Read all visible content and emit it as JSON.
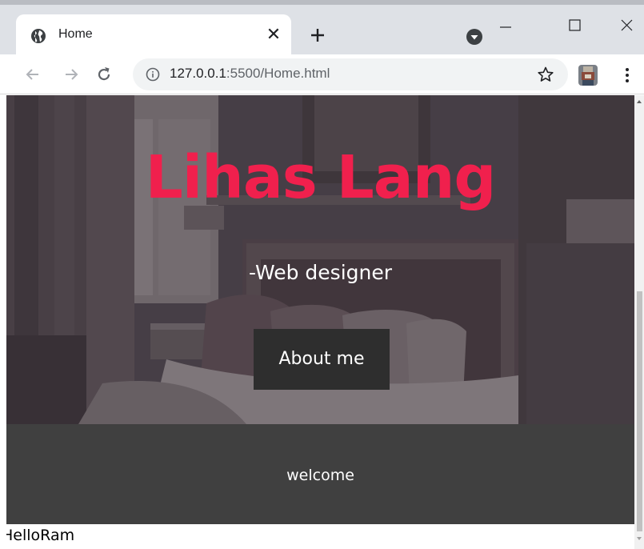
{
  "browser": {
    "tab": {
      "title": "Home",
      "favicon": "globe-icon",
      "close_glyph": "✕"
    },
    "new_tab_icon": "plus-icon",
    "media_icon": "media-control-icon",
    "window_controls": [
      "minimize-icon",
      "maximize-icon",
      "close-icon"
    ],
    "nav": {
      "back_icon": "back-arrow-icon",
      "forward_icon": "forward-arrow-icon",
      "reload_icon": "reload-icon"
    },
    "address": {
      "info_icon": "info-icon",
      "host": "127.0.0.1",
      "path": ":5500/Home.html",
      "bookmark_icon": "star-icon"
    },
    "profile_icon": "avatar",
    "menu_icon": "kebab-menu-icon"
  },
  "page": {
    "hero": {
      "title": "Lihas Lang",
      "subtitle": "-Web designer",
      "button_label": "About me"
    },
    "welcome": {
      "text": "welcome"
    },
    "footer_text": "HelloRam"
  },
  "colors": {
    "accent": "#f0204d",
    "button_bg": "#2e2e2e",
    "welcome_bg": "#404040",
    "tabbar_bg": "#dee1e6"
  }
}
